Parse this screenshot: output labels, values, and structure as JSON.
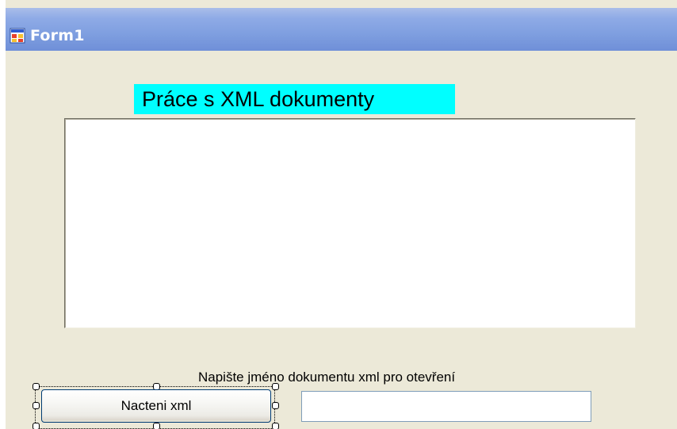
{
  "window": {
    "title": "Form1",
    "icon": "form-app-icon"
  },
  "form": {
    "heading": "Práce s XML dokumenty",
    "heading_bg": "#00ffff",
    "output_text": "",
    "filename_label": "Napište jméno dokumentu xml pro otevření",
    "load_button_label": "Nacteni xml",
    "filename_value": "",
    "filename_placeholder": ""
  },
  "colors": {
    "titlebar": "#7f9fe0",
    "form_background": "#ece9d8",
    "input_border": "#7f9db9",
    "button_border": "#003c74"
  }
}
